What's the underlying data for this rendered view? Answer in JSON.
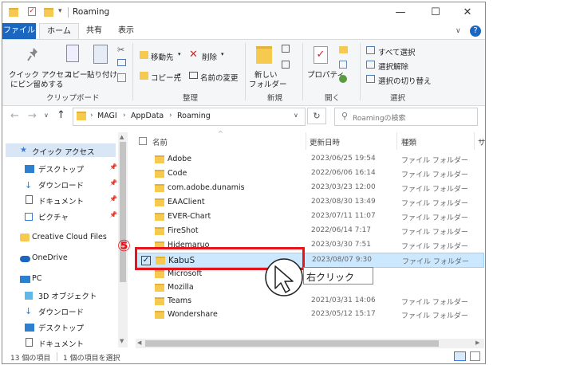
{
  "window": {
    "title": "Roaming",
    "controls": {
      "minimize": "—",
      "maximize": "☐",
      "close": "✕"
    }
  },
  "ribbon_tabs": [
    "ファイル",
    "ホーム",
    "共有",
    "表示"
  ],
  "ribbon": {
    "clipboard": {
      "pin_label_1": "クイック アクセス",
      "pin_label_2": "にピン留めする",
      "copy": "コピー",
      "paste": "貼り付け",
      "group": "クリップボード"
    },
    "organize": {
      "move_to": "移動先",
      "delete": "削除",
      "copy_to": "コピー先",
      "rename": "名前の変更",
      "group": "整理"
    },
    "new": {
      "new_folder_1": "新しい",
      "new_folder_2": "フォルダー",
      "group": "新規"
    },
    "open": {
      "properties": "プロパティ",
      "group": "開く"
    },
    "select": {
      "select_all": "すべて選択",
      "select_none": "選択解除",
      "invert": "選択の切り替え",
      "group": "選択"
    }
  },
  "address": {
    "crumbs": [
      "MAGI",
      "AppData",
      "Roaming"
    ],
    "search_placeholder": "Roamingの検索"
  },
  "nav": {
    "quick_access": "クイック アクセス",
    "desktop": "デスクトップ",
    "downloads": "ダウンロード",
    "documents": "ドキュメント",
    "pictures": "ピクチャ",
    "creative_cloud": "Creative Cloud Files",
    "onedrive": "OneDrive",
    "pc": "PC",
    "objects3d": "3D オブジェクト",
    "pc_downloads": "ダウンロード",
    "pc_desktop": "デスクトップ",
    "pc_documents": "ドキュメント"
  },
  "columns": {
    "name": "名前",
    "date": "更新日時",
    "type": "種類",
    "size": "サ"
  },
  "files": [
    {
      "name": "Adobe",
      "date": "2023/06/25 19:54",
      "type": "ファイル フォルダー"
    },
    {
      "name": "Code",
      "date": "2022/06/06 16:14",
      "type": "ファイル フォルダー"
    },
    {
      "name": "com.adobe.dunamis",
      "date": "2023/03/23 12:00",
      "type": "ファイル フォルダー"
    },
    {
      "name": "EAAClient",
      "date": "2023/08/30 13:49",
      "type": "ファイル フォルダー"
    },
    {
      "name": "EVER-Chart",
      "date": "2023/07/11 11:07",
      "type": "ファイル フォルダー"
    },
    {
      "name": "FireShot",
      "date": "2022/06/14 7:17",
      "type": "ファイル フォルダー"
    },
    {
      "name": "Hidemaruo",
      "date": "2023/03/30 7:51",
      "type": "ファイル フォルダー"
    },
    {
      "name": "KabuS",
      "date": "2023/08/07 9:30",
      "type": "ファイル フォルダー"
    },
    {
      "name": "Microsoft",
      "date": "",
      "type": ""
    },
    {
      "name": "Mozilla",
      "date": "",
      "type": ""
    },
    {
      "name": "Teams",
      "date": "2021/03/31 14:06",
      "type": "ファイル フォルダー"
    },
    {
      "name": "Wondershare",
      "date": "2023/05/12 15:17",
      "type": "ファイル フォルダー"
    }
  ],
  "status": {
    "count": "13 個の項目",
    "selected": "1 個の項目を選択"
  },
  "annotation": {
    "step": "⑤",
    "callout": "右クリック"
  },
  "colors": {
    "accent": "#1a66c0",
    "selection": "#cce8ff",
    "highlight_border": "#e8141b"
  }
}
